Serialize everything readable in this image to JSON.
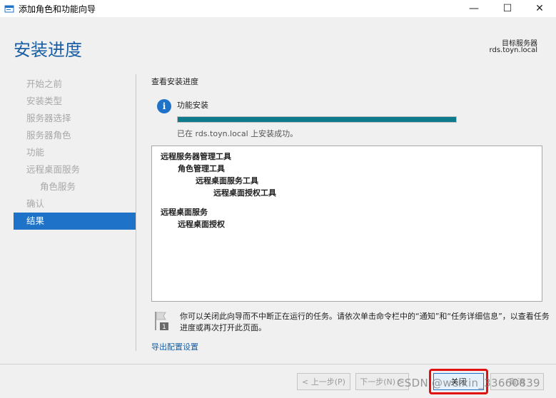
{
  "window": {
    "title": "添加角色和功能向导",
    "minimize_glyph": "—",
    "maximize_glyph": "☐",
    "close_glyph": "✕"
  },
  "header": {
    "page_title": "安装进度",
    "target_label": "目标服务器",
    "target_value": "rds.toyn.local"
  },
  "sidebar": {
    "items": [
      {
        "label": "开始之前",
        "state": "disabled"
      },
      {
        "label": "安装类型",
        "state": "disabled"
      },
      {
        "label": "服务器选择",
        "state": "disabled"
      },
      {
        "label": "服务器角色",
        "state": "disabled"
      },
      {
        "label": "功能",
        "state": "disabled"
      },
      {
        "label": "远程桌面服务",
        "state": "disabled"
      },
      {
        "label": "角色服务",
        "state": "disabled"
      },
      {
        "label": "确认",
        "state": "disabled"
      },
      {
        "label": "结果",
        "state": "active"
      }
    ]
  },
  "main": {
    "section_label": "查看安装进度",
    "feature_label": "功能安装",
    "progress_fraction": 1.0,
    "status_text": "已在 rds.toyn.local 上安装成功。",
    "results": [
      {
        "text": "远程服务器管理工具",
        "level": 0
      },
      {
        "text": "角色管理工具",
        "level": 1
      },
      {
        "text": "远程桌面服务工具",
        "level": 2
      },
      {
        "text": "远程桌面授权工具",
        "level": 3
      },
      {
        "text": "远程桌面服务",
        "level": 0
      },
      {
        "text": "远程桌面授权",
        "level": 1
      }
    ],
    "note_text": "你可以关闭此向导而不中断正在运行的任务。请依次单击命令栏中的“通知”和“任务详细信息”，以查看任务进度或再次打开此页面。",
    "note_flag_badge": "1",
    "export_link": "导出配置设置"
  },
  "footer": {
    "prev_label": "< 上一步(P)",
    "next_label": "下一步(N) >",
    "close_label": "关闭",
    "cancel_label": "取消",
    "watermark": "CSDN @weixin_33660839"
  },
  "colors": {
    "accent": "#1e73c8",
    "title_blue": "#1a5fa3",
    "progress": "#0e7a8c",
    "highlight_red": "#e01010"
  }
}
